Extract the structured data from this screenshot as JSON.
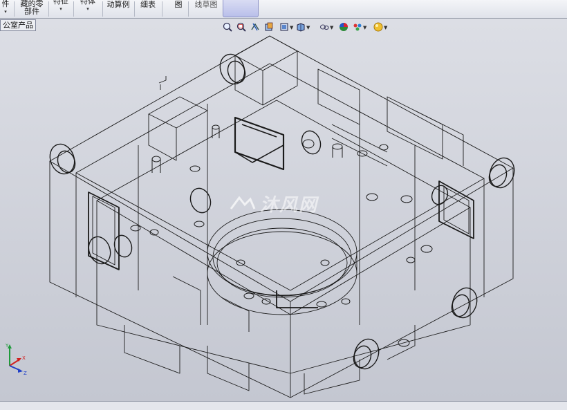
{
  "toolbar": {
    "items": [
      {
        "label": "件",
        "sub": "▾"
      },
      {
        "label": "藏的零",
        "sub": "部件"
      },
      {
        "label": "特征",
        "sub": "▾"
      },
      {
        "label": "特体",
        "sub": "▾"
      },
      {
        "label": "动算例",
        "sub": ""
      },
      {
        "label": "细表",
        "sub": ""
      },
      {
        "label": "图",
        "sub": ""
      },
      {
        "label": "线草图",
        "sub": ""
      }
    ]
  },
  "tree": {
    "label": "公室产品"
  },
  "view_tools": [
    "zoom-to-fit-icon",
    "zoom-area-icon",
    "previous-view-icon",
    "section-view-icon",
    "view-orientation-icon",
    "display-style-icon",
    "hide-show-icon",
    "edit-appearance-icon",
    "apply-scene-icon",
    "view-settings-icon"
  ],
  "watermark": {
    "text": "沐风网"
  },
  "colors": {
    "viewport_top": "#dcdee5",
    "viewport_bottom": "#c4c7d1",
    "wire": "#1a1a1a",
    "axis_x": "#d12020",
    "axis_y": "#1f9a3b",
    "axis_z": "#2140c8"
  },
  "triad": {
    "x": "X",
    "y": "Y",
    "z": "Z"
  }
}
